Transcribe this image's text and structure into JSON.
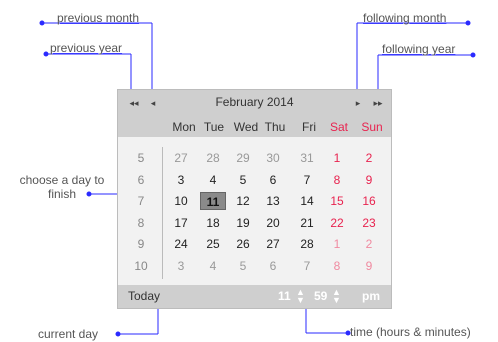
{
  "annotations": {
    "previous_month": "previous month",
    "previous_year": "previous year",
    "following_month": "following month",
    "following_year": "following year",
    "choose_day": "choose a day to finish",
    "current_day": "current day",
    "time": "time (hours & minutes)"
  },
  "calendar": {
    "title": "February 2014",
    "nav": {
      "prev_year": "◂◂",
      "prev_month": "◂",
      "next_month": "▸",
      "next_year": "▸▸"
    },
    "weekdays": [
      "Mon",
      "Tue",
      "Wed",
      "Thu",
      "Fri",
      "Sat",
      "Sun"
    ],
    "weeks": [
      {
        "num": "5",
        "days": [
          {
            "d": "27",
            "o": true
          },
          {
            "d": "28",
            "o": true
          },
          {
            "d": "29",
            "o": true
          },
          {
            "d": "30",
            "o": true
          },
          {
            "d": "31",
            "o": true
          },
          {
            "d": "1",
            "o": false
          },
          {
            "d": "2",
            "o": false
          }
        ]
      },
      {
        "num": "6",
        "days": [
          {
            "d": "3",
            "o": false
          },
          {
            "d": "4",
            "o": false
          },
          {
            "d": "5",
            "o": false
          },
          {
            "d": "6",
            "o": false
          },
          {
            "d": "7",
            "o": false
          },
          {
            "d": "8",
            "o": false
          },
          {
            "d": "9",
            "o": false
          }
        ]
      },
      {
        "num": "7",
        "days": [
          {
            "d": "10",
            "o": false
          },
          {
            "d": "11",
            "o": false,
            "sel": true
          },
          {
            "d": "12",
            "o": false
          },
          {
            "d": "13",
            "o": false
          },
          {
            "d": "14",
            "o": false
          },
          {
            "d": "15",
            "o": false
          },
          {
            "d": "16",
            "o": false
          }
        ]
      },
      {
        "num": "8",
        "days": [
          {
            "d": "17",
            "o": false
          },
          {
            "d": "18",
            "o": false
          },
          {
            "d": "19",
            "o": false
          },
          {
            "d": "20",
            "o": false
          },
          {
            "d": "21",
            "o": false
          },
          {
            "d": "22",
            "o": false
          },
          {
            "d": "23",
            "o": false
          }
        ]
      },
      {
        "num": "9",
        "days": [
          {
            "d": "24",
            "o": false
          },
          {
            "d": "25",
            "o": false
          },
          {
            "d": "26",
            "o": false
          },
          {
            "d": "27",
            "o": false
          },
          {
            "d": "28",
            "o": false
          },
          {
            "d": "1",
            "o": true
          },
          {
            "d": "2",
            "o": true
          }
        ]
      },
      {
        "num": "10",
        "days": [
          {
            "d": "3",
            "o": true
          },
          {
            "d": "4",
            "o": true
          },
          {
            "d": "5",
            "o": true
          },
          {
            "d": "6",
            "o": true
          },
          {
            "d": "7",
            "o": true
          },
          {
            "d": "8",
            "o": true
          },
          {
            "d": "9",
            "o": true
          }
        ]
      }
    ],
    "footer": {
      "today": "Today",
      "hours": "11",
      "minutes": "59",
      "ampm": "pm"
    }
  },
  "colors": {
    "annotation_line": "#2a2aff",
    "weekend": "#e8234f",
    "header_bg": "#cfcfcf"
  }
}
